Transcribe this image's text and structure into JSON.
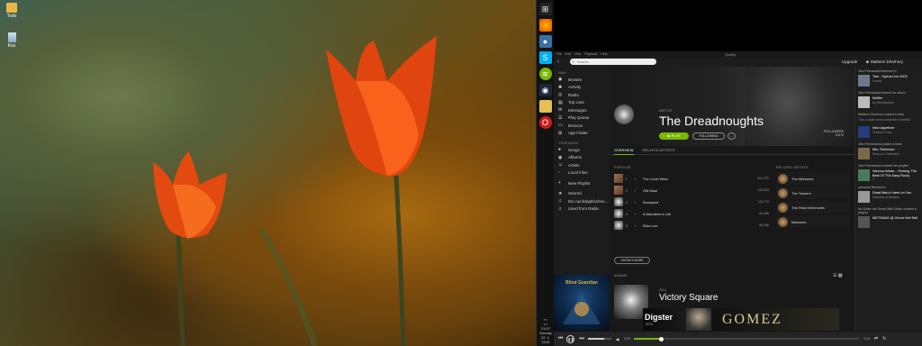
{
  "desktop": {
    "icons": [
      {
        "label": "Todo"
      },
      {
        "label": "Kos"
      }
    ]
  },
  "taskbar": {
    "icons": [
      "windows-start-icon",
      "firefox-icon",
      "chat-icon",
      "skype-icon",
      "spotify-icon",
      "steam-icon",
      "folder-icon",
      "opera-icon"
    ],
    "time": "21:07",
    "day": "Sunday",
    "date": "22. 1. 2015"
  },
  "window": {
    "title": "Spotify",
    "menu": [
      "File",
      "Edit",
      "View",
      "Playback",
      "Help"
    ]
  },
  "topbar": {
    "search_placeholder": "Search",
    "upgrade": "Upgrade",
    "username": "Matteen Dharhory"
  },
  "sidebar": {
    "main_header": "MAIN",
    "main_items": [
      {
        "label": "Browse",
        "icon": "browse-icon"
      },
      {
        "label": "Activity",
        "icon": "activity-icon"
      },
      {
        "label": "Radio",
        "icon": "radio-icon"
      },
      {
        "label": "Top Lists",
        "icon": "toplists-icon"
      },
      {
        "label": "Messages",
        "icon": "messages-icon"
      },
      {
        "label": "Play Queue",
        "icon": "queue-icon"
      },
      {
        "label": "Devices",
        "icon": "devices-icon"
      },
      {
        "label": "App Finder",
        "icon": "appfinder-icon"
      }
    ],
    "music_header": "YOUR MUSIC",
    "music_items": [
      {
        "label": "Songs",
        "icon": "songs-icon"
      },
      {
        "label": "Albums",
        "icon": "albums-icon"
      },
      {
        "label": "Artists",
        "icon": "artists-icon"
      },
      {
        "label": "Local Files",
        "icon": "localfiles-icon"
      }
    ],
    "new_playlist": "New Playlist",
    "playlists": [
      {
        "label": "Starred",
        "icon": "star-icon"
      },
      {
        "label": "Die Apokalyptischen...",
        "icon": "playlist-icon"
      },
      {
        "label": "Liked from Radio",
        "icon": "playlist-icon"
      }
    ],
    "cover_text": "Blind Guardian",
    "now_playing_title": "Sacred Worlds",
    "now_playing_artist": "Blind Guardian"
  },
  "artist": {
    "label": "ARTIST",
    "name": "The Dreadnoughts",
    "play": "PLAY",
    "following": "FOLLOWING",
    "more": "...",
    "followers_label": "FOLLOWERS",
    "followers": "8,570",
    "tabs": [
      "OVERVIEW",
      "RELATED ARTISTS"
    ],
    "popular_header": "POPULAR",
    "tracks": [
      {
        "n": "1",
        "title": "The Cruel Wars",
        "count": "201,270"
      },
      {
        "n": "2",
        "title": "Old Maui",
        "count": "133,453"
      },
      {
        "n": "3",
        "title": "Boneyard",
        "count": "110,774"
      },
      {
        "n": "4",
        "title": "A Wanderer's Life",
        "count": "64,386"
      },
      {
        "n": "5",
        "title": "Eliza Lee",
        "count": "59,286"
      }
    ],
    "show_more": "SHOW 5 MORE",
    "related_header": "RELATED ARTISTS",
    "related": [
      {
        "name": "The Mahones"
      },
      {
        "name": "The Tossers"
      },
      {
        "name": "The Real McKenzies"
      },
      {
        "name": "Mahones"
      }
    ],
    "albums_header": "ALBUMS",
    "album_year": "2014",
    "album_name": "Victory Square",
    "album_save": "SAVE"
  },
  "ad": {
    "brand": "Digster",
    "sub": "HITS",
    "headline": "GOMEZ"
  },
  "feed": [
    {
      "who": "Jiha Pelmasdust",
      "action": "listened to",
      "title": "Tom - Opera Live 2003",
      "sub": "Levels"
    },
    {
      "who": "Jiha Pelmasdust",
      "action": "shared an album",
      "title": "Muffler",
      "sub": "by Stevekulture"
    },
    {
      "who": "Matteen Dharhory",
      "action": "shared a track",
      "title": "\"Tak a radši sami pozápráté rozmetla\"",
      "sub": ""
    },
    {
      "who": "",
      "action": "",
      "title": "New Appetizer",
      "sub": "Pohlaus Tuns"
    },
    {
      "who": "Jiha Pelmasdust",
      "action": "posted a track",
      "title": "Mrs. Robinson",
      "sub": "Simon & Garfunkel"
    },
    {
      "who": "Jiha Pelmasdust",
      "action": "created the playlist",
      "title": "Various Artists – Shining '70s Best Of '70s Easy Rock)",
      "sub": "2"
    },
    {
      "who": "cymsdotl",
      "action": "listened to",
      "title": "Dead Man's Hand on You",
      "sub": "Chimera of Bodane"
    },
    {
      "who": "No Sutter the Dread With Sutter",
      "action": "created a playlist",
      "title": "METDNAS @ Chrob Hell Setl",
      "sub": ""
    }
  ],
  "player": {
    "elapsed": "0:29",
    "total": "3:15",
    "progress": 0.12,
    "volume": 0.7
  }
}
